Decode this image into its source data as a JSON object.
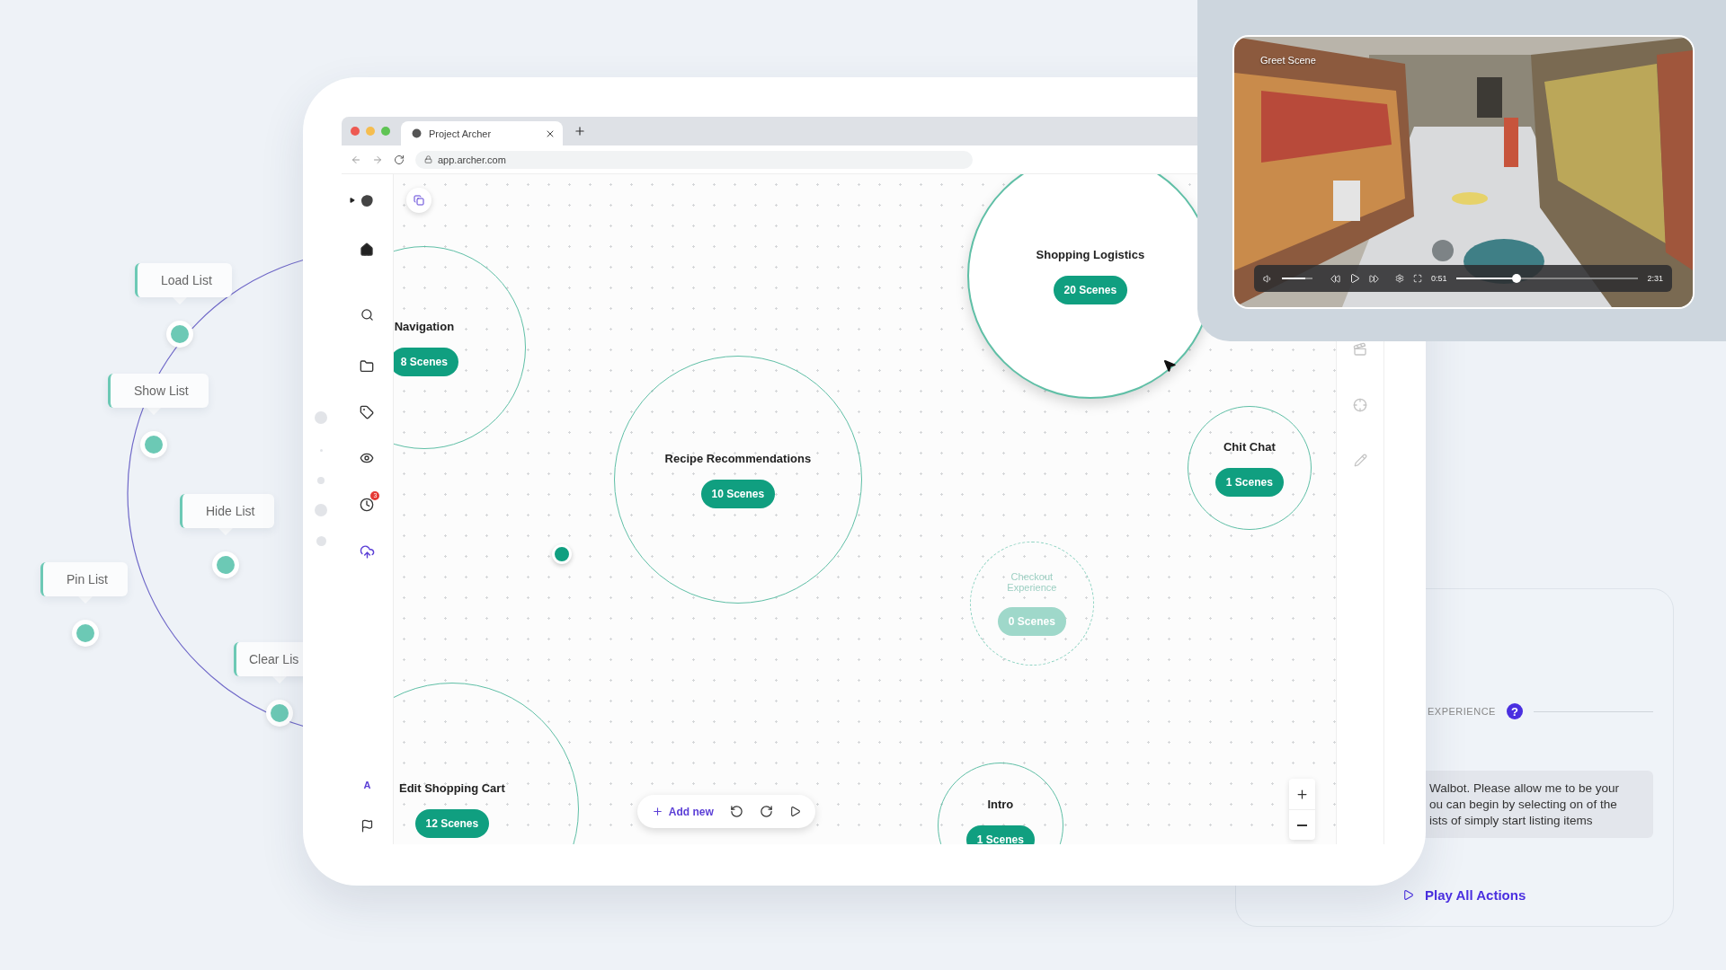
{
  "flow_labels": [
    {
      "label": "Load List"
    },
    {
      "label": "Show List"
    },
    {
      "label": "Hide List"
    },
    {
      "label": "Pin List"
    },
    {
      "label": "Clear Lis"
    }
  ],
  "browser": {
    "tab_title": "Project Archer",
    "url": "app.archer.com"
  },
  "sidebar": {
    "notification_count": "3",
    "avatar_letter": "A"
  },
  "nodes": [
    {
      "title": "Navigation",
      "count": "8 Scenes",
      "selected": false,
      "disabled": false
    },
    {
      "title": "Recipe Recommendations",
      "count": "10 Scenes",
      "selected": false,
      "disabled": false
    },
    {
      "title": "Shopping Logistics",
      "count": "20 Scenes",
      "selected": true,
      "disabled": false
    },
    {
      "title": "Chit Chat",
      "count": "1 Scenes",
      "selected": false,
      "disabled": false
    },
    {
      "title": "Checkout Experience",
      "count": "0 Scenes",
      "selected": false,
      "disabled": true
    },
    {
      "title": "Edit Shopping Cart",
      "count": "12 Scenes",
      "selected": false,
      "disabled": false
    },
    {
      "title": "Intro",
      "count": "1 Scenes",
      "selected": false,
      "disabled": false
    }
  ],
  "toolbar": {
    "add_label": "Add new"
  },
  "video": {
    "scene_title": "Greet Scene",
    "current_time": "0:51",
    "duration": "2:31",
    "progress": {
      "level": 0.33
    },
    "volume": {
      "level": 0.75
    }
  },
  "experience_panel": {
    "section_label": "EXPERIENCE",
    "help_icon": "?",
    "message_lines": [
      "Walbot. Please allow me to be your",
      "ou can begin by selecting on of the",
      "ists of simply start listing items"
    ],
    "action_label": "Play All Actions"
  }
}
